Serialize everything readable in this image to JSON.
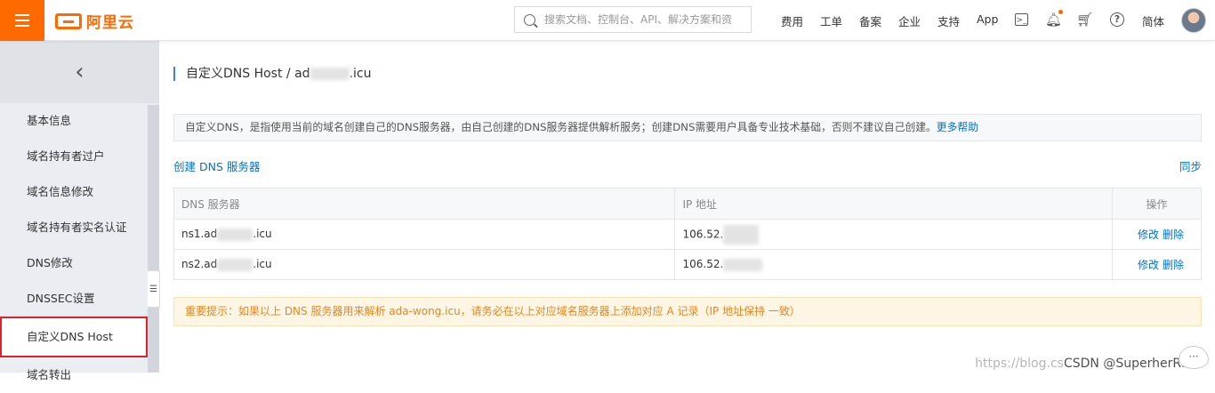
{
  "topbar": {
    "brand": "阿里云",
    "search_placeholder": "搜索文档、控制台、API、解决方案和资",
    "nav": [
      "费用",
      "工单",
      "备案",
      "企业",
      "支持",
      "App"
    ],
    "lang": "简体",
    "accent": "#ff6a00"
  },
  "sidebar": {
    "back_glyph": "‹",
    "items": [
      "基本信息",
      "域名持有者过户",
      "域名信息修改",
      "域名持有者实名认证",
      "DNS修改",
      "DNSSEC设置",
      "自定义DNS Host",
      "域名转出"
    ],
    "active_index": 6
  },
  "main": {
    "title_prefix": "自定义DNS Host / ad",
    "title_suffix": ".icu",
    "notice": "自定义DNS，是指使用当前的域名创建自己的DNS服务器，由自己创建的DNS服务器提供解析服务；创建DNS需要用户具备专业技术基础，否则不建议自己创建。",
    "notice_link": "更多帮助",
    "create_link": "创建 DNS 服务器",
    "sync_link": "同步",
    "table": {
      "headers": [
        "DNS 服务器",
        "IP 地址",
        "操作"
      ],
      "rows": [
        {
          "dns_prefix": "ns1.ad",
          "dns_suffix": ".icu",
          "ip_prefix": "106.52.",
          "edit": "修改",
          "delete": "删除"
        },
        {
          "dns_prefix": "ns2.ad",
          "dns_suffix": ".icu",
          "ip_prefix": "106.52.",
          "edit": "修改",
          "delete": "删除"
        }
      ]
    },
    "warning": "重要提示：如果以上 DNS 服务器用来解析 ada-wong.icu，请务必在以上对应域名服务器上添加对应 A 记录（IP 地址保持 一致）"
  },
  "watermark": {
    "url": "https://blog.cs",
    "csdn": "CSDN @SuperherRo"
  }
}
